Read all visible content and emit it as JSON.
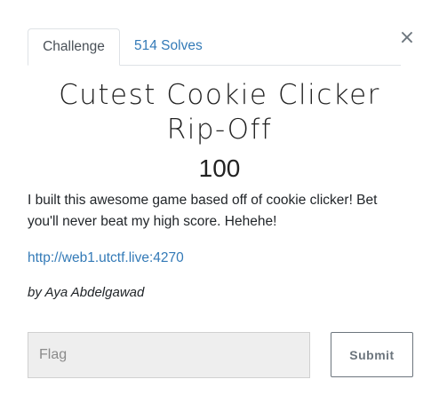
{
  "tabs": {
    "challenge_label": "Challenge",
    "solves_label": "514 Solves"
  },
  "close_glyph": "×",
  "challenge": {
    "title": "Cutest Cookie Clicker Rip-Off",
    "value": "100",
    "description": "I built this awesome game based off of cookie clicker! Bet you'll never beat my high score. Hehehe!",
    "url": "http://web1.utctf.live:4270",
    "author": "by Aya Abdelgawad"
  },
  "flag_form": {
    "placeholder": "Flag",
    "value": "",
    "submit_label": "Submit"
  },
  "colors": {
    "link": "#337ab7",
    "input_bg": "#eeeeee",
    "button_border": "#6c757d"
  }
}
